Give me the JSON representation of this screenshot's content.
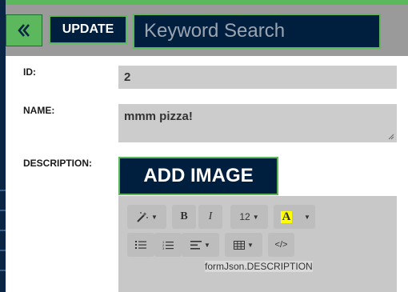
{
  "toolbar": {
    "back_icon": "double-chevron-left-icon",
    "update_label": "UPDATE",
    "search_placeholder": "Keyword Search"
  },
  "form": {
    "id_label": "ID:",
    "id_value": "2",
    "name_label": "NAME:",
    "name_value": "mmm pizza!",
    "description_label": "DESCRIPTION:",
    "add_image_label": "ADD IMAGE"
  },
  "editor": {
    "font_size": "12",
    "code_label": "</>",
    "content": "formJson.DESCRIPTION",
    "icons": [
      "magic-wand-icon",
      "bold-icon",
      "italic-icon",
      "font-size-dropdown",
      "text-color-icon",
      "color-dropdown-icon",
      "unordered-list-icon",
      "ordered-list-icon",
      "align-icon",
      "table-icon",
      "code-view-icon"
    ]
  },
  "colors": {
    "accent_green": "#5cb85c",
    "navy": "#001f3f",
    "toolbar_gray": "#9a9a9a",
    "field_gray": "#cccccc"
  }
}
